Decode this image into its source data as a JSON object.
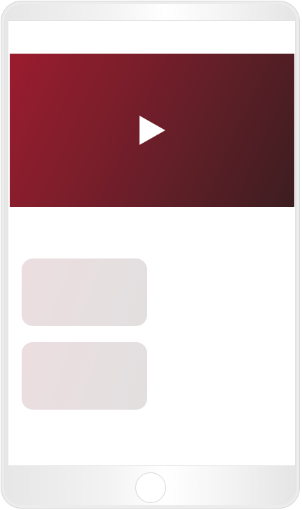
{
  "device": {
    "type": "tablet-mockup"
  },
  "video": {
    "icon": "play-icon",
    "gradient_colors": [
      "#9a1c2e",
      "#3c1d20"
    ]
  },
  "cards": [
    {
      "fill": "#ecdde0"
    },
    {
      "fill": "#ecdde0"
    }
  ],
  "home_button": {
    "icon": "home-button"
  }
}
